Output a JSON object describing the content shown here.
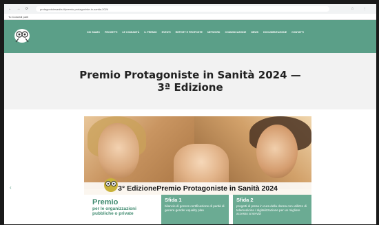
{
  "browser": {
    "url": "protagonistesanita.it/premio-protagoniste-in-sanita-2024",
    "nav_glyphs": "← → ⟳",
    "right_glyphs": "☆ ⋮",
    "bookmark": "Tu Concedi parli"
  },
  "nav": {
    "items": [
      "Chi siamo",
      "Progetti",
      "Le comunità",
      "Il premio",
      "Eventi",
      "Report e proposte",
      "Network",
      "Comunicazione",
      "News",
      "Documentazione",
      "Contatti"
    ]
  },
  "hero": {
    "title_line1": "Premio Protagoniste in Sanità 2024 —",
    "title_line2": "3ª Edizione"
  },
  "banner": {
    "edition_prefix": "3° Edizione ",
    "edition_highlight": "Premio Protagoniste in Sanità 2024",
    "premio_title": "Premio",
    "premio_sub1": "per le organizzazioni",
    "premio_sub2": "pubbliche o private",
    "sfida1_title": "Sfida 1",
    "sfida1_desc": "bilancio di genere certificazione di parità di genere gender equality plan",
    "sfida2_title": "Sfida 2",
    "sfida2_desc": "progetti di presa in cura della donna con utilizzo di telemedicina / digitalizzazione per un migliore accesso ai servizi"
  },
  "colors": {
    "header_green": "#5b9f88",
    "accent_green": "#3f8a6f",
    "title_band": "#f2f2f2"
  }
}
